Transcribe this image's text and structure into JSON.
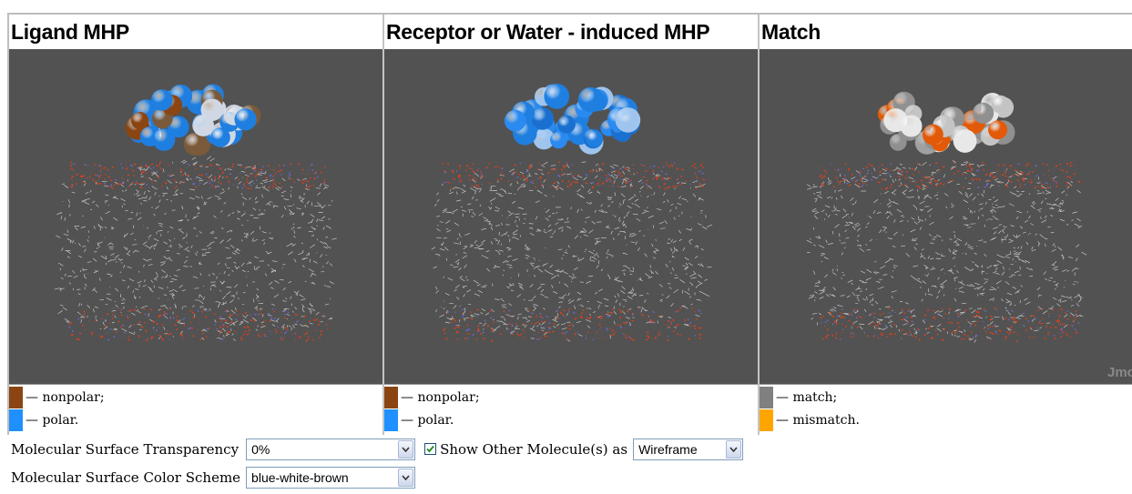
{
  "panels": [
    {
      "title": "Ligand MHP",
      "legend": [
        {
          "label": "— nonpolar;",
          "color": "#8b4513"
        },
        {
          "label": "— polar.",
          "color": "#1e90ff"
        }
      ]
    },
    {
      "title": "Receptor or Water - induced MHP",
      "legend": [
        {
          "label": "— nonpolar;",
          "color": "#8b4513"
        },
        {
          "label": "— polar.",
          "color": "#1e90ff"
        }
      ]
    },
    {
      "title": "Match",
      "legend": [
        {
          "label": "— match;",
          "color": "#808080"
        },
        {
          "label": "— mismatch.",
          "color": "#ffa500"
        }
      ],
      "watermark": "Jmol"
    }
  ],
  "controls": {
    "transparency_label": "Molecular Surface Transparency",
    "transparency_value": "0%",
    "show_other_label": "Show Other Molecule(s) as",
    "show_other_checked": true,
    "render_mode_value": "Wireframe",
    "color_scheme_label": "Molecular Surface Color Scheme",
    "color_scheme_value": "blue-white-brown"
  },
  "colors": {
    "viewer_bg": "#525252",
    "brown": "#8b4513",
    "blue": "#1e90ff",
    "grey": "#808080",
    "orange": "#ff6a00"
  }
}
